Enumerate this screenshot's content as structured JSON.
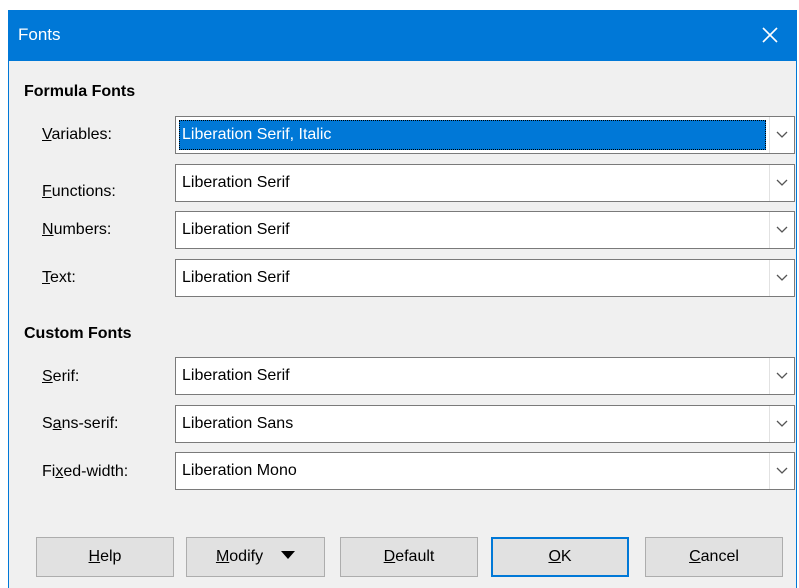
{
  "window": {
    "title": "Fonts"
  },
  "formula_fonts": {
    "heading": "Formula Fonts",
    "rows": [
      {
        "label_mnemonic": "V",
        "label_rest": "ariables:",
        "value": "Liberation Serif, Italic",
        "selected": true
      },
      {
        "label_mnemonic": "F",
        "label_rest": "unctions:",
        "value": "Liberation Serif",
        "selected": false
      },
      {
        "label_mnemonic": "N",
        "label_rest": "umbers:",
        "value": "Liberation Serif",
        "selected": false
      },
      {
        "label_mnemonic": "T",
        "label_rest": "ext:",
        "value": "Liberation Serif",
        "selected": false
      }
    ]
  },
  "custom_fonts": {
    "heading": "Custom Fonts",
    "rows": [
      {
        "label_before": "",
        "label_mnemonic": "S",
        "label_rest": "erif:",
        "value": "Liberation Serif"
      },
      {
        "label_before": "S",
        "label_mnemonic": "a",
        "label_rest": "ns-serif:",
        "value": "Liberation Sans"
      },
      {
        "label_before": "Fi",
        "label_mnemonic": "x",
        "label_rest": "ed-width:",
        "value": "Liberation Mono"
      }
    ]
  },
  "buttons": {
    "help": {
      "mnemonic": "H",
      "rest": "elp"
    },
    "modify": {
      "mnemonic": "M",
      "rest": "odify"
    },
    "default": {
      "mnemonic": "D",
      "rest": "efault"
    },
    "ok": {
      "mnemonic": "O",
      "rest": "K"
    },
    "cancel": {
      "mnemonic": "C",
      "rest": "ancel"
    }
  },
  "icons": {
    "close": "close-icon",
    "combo_arrow": "chevron-down-icon",
    "modify_menu": "caret-down-icon"
  },
  "colors": {
    "accent": "#0078d7",
    "dialog_background": "#f0f0f0",
    "button_face": "#e1e1e1"
  }
}
